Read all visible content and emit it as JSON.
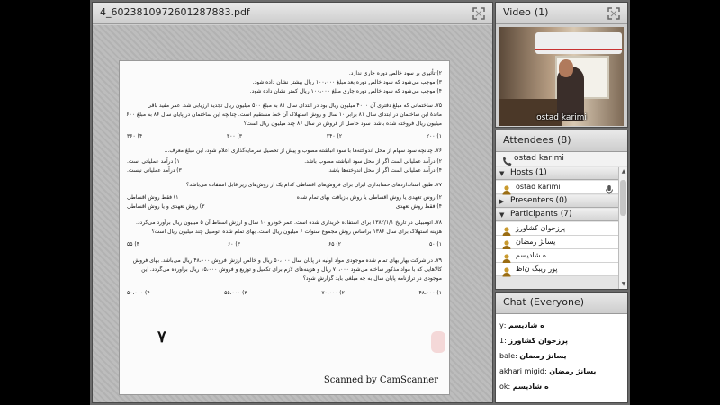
{
  "doc_pod": {
    "title": "4_6023810972601287883.pdf",
    "icon": "maximize-icon"
  },
  "document": {
    "lines": [
      "۲) تأثیری بر سود خالص دوره جاری ندارد.",
      "۳) موجب می‌شود که سود خالص دوره بعد مبلغ ۱۰۰،۰۰۰ ریال بیشتر نشان داده شود.",
      "۴) موجب می‌شود که سود خالص دوره جاری مبلغ ۱۰۰،۰۰۰ ریال کمتر نشان داده شود.",
      "۷۵ـ ساختمانی که مبلغ دفتری آن ۴۰۰۰ میلیون ریال بود در ابتدای سال ۸۱ به مبلغ ۵۰۰ میلیون ریال تجدید ارزیابی شد. عمر مفید باقی",
      "ماندهٔ این ساختمان در ابتدای سال ۸۱ برابر ۱۰ سال و روش استهلاک آن خط مستقیم است. چنانچه این ساختمان در پایان سال ۸۶ به مبلغ ۶۰۰",
      "میلیون ریال فروخته شده باشد، سود حاصل از فروش در سال ۸۶ چند میلیون ریال است؟",
      "۷۶ـ چنانچه سود سهام از محل اندوخته‌ها با سود انباشته مصوب و پیش از تحصیل سرمایه‌گذاری اعلام شود، این مبلغ معرف...",
      "۷۷ـ طبق استانداردهای حسابداری ایران برای فروش‌های اقساطی کدام یک از روش‌های زیر قابل استفاده می‌باشد؟",
      "۷۸ـ اتومبیلی در تاریخ ۱۳۸۲/۱/۱ برای استفاده خریداری شده است. عمر خودرو ۱۰ سال و ارزش اسقاط آن ۵ میلیون ریال برآورد می‌گردد.",
      "هزینه استهلاک برای سال ۱۳۸۶ براساس روش مجموع سنوات ۶ میلیون ریال است. بهای تمام شده اتومبیل چند میلیون ریال است؟",
      "۷۹ـ در شرکت بهار بهای تمام شده موجودی مواد اولیه در پایان سال ۵۰،۰۰۰ ریال و خالص ارزش فروش ۴۸،۰۰۰ ریال می‌باشد. بهای فروش",
      "کالاهایی که با مواد مذکور ساخته می‌شود ۷۰،۰۰۰ ریال و هزینه‌های لازم برای تکمیل و توزیع و فروش ۱۵،۰۰۰ ریال برآورده می‌گردد. این",
      "موجودی در ترازنامه پایان سال به چه مبلغی باید گزارش شود؟"
    ],
    "q75_options": [
      "۱) ۲۰۰",
      "۲) ۲۴۰",
      "۳) ۳۰۰",
      "۴) ۳۶۰"
    ],
    "q76_options_a": [
      "۱) درآمد عملیاتی است.",
      "۲) درآمد عملیاتی است اگر از محل سود انباشته مصوب باشد."
    ],
    "q76_options_b": [
      "۳) درآمد عملیاتی نیست.",
      "۴) درآمد عملیاتی است اگر از محل اندوخته‌ها باشد."
    ],
    "q77_options_a": [
      "۱) فقط روش اقساطی",
      "۲) روش تعهدی یا روش اقساطی یا روش بازیافت بهای تمام شده"
    ],
    "q77_options_b": [
      "۳) روش تعهدی و یا روش اقساطی",
      "۴) فقط روش تعهدی"
    ],
    "q78_options": [
      "۱) ۵۰",
      "۲) ۶۵",
      "۳) ۶۰",
      "۴) ۵۵"
    ],
    "q79_options": [
      "۱) ۴۸،۰۰۰",
      "۲) ۷۰،۰۰۰",
      "۳) ۵۵،۰۰۰",
      "۴) ۵۰،۰۰۰"
    ],
    "scribble": "۷",
    "scanned_label": "Scanned by CamScanner"
  },
  "video_pod": {
    "title": "Video",
    "count": "(1)",
    "speaker_name": "ostad karimi",
    "icon": "maximize-icon"
  },
  "attendees_pod": {
    "title": "Attendees",
    "count": "(8)",
    "toolbar_user": "ostad karimi",
    "hosts_label": "Hosts (1)",
    "hosts": [
      "ostad karimi"
    ],
    "presenters_label": "Presenters (0)",
    "participants_label": "Participants (7)",
    "participants": [
      "پرزحوان کشاورز",
      "یسانژ رمضان",
      "ه شادیسم",
      "پور ریبگ ن‌اظ"
    ]
  },
  "chat_pod": {
    "title": "Chat",
    "scope": "(Everyone)",
    "messages": [
      {
        "who": "ه شادیسم",
        "text": "y"
      },
      {
        "who": "پرزحوان کشاورز",
        "text": "1"
      },
      {
        "who": "یسانژ رمضان",
        "text": "bale"
      },
      {
        "who": "یسانژ رمضان",
        "text": "akhari migid"
      },
      {
        "who": "ه شادیسم",
        "text": "ok"
      }
    ]
  },
  "colors": {
    "pod_border": "#4a4a4a",
    "header_light": "#e9e9e9",
    "stage_gray": "#6b6b6b"
  }
}
